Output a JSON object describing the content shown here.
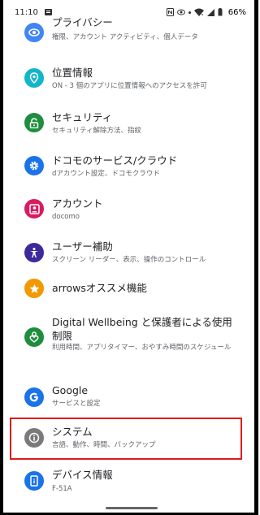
{
  "status_bar": {
    "time": "11:10",
    "battery": "66%"
  },
  "settings": {
    "items": [
      {
        "key": "privacy",
        "title": "プライバシー",
        "subtitle": "権限、アカウント アクティビティ、個人データ",
        "icon": "eye-icon",
        "color": "#4285f4"
      },
      {
        "key": "location",
        "title": "位置情報",
        "subtitle": "ON - 3 個のアプリに位置情報へのアクセスを許可",
        "icon": "location-pin-icon",
        "color": "#12b5cb"
      },
      {
        "key": "security",
        "title": "セキュリティ",
        "subtitle": "セキュリティ解除方法、指紋",
        "icon": "lock-icon",
        "color": "#1e8e3e"
      },
      {
        "key": "docomo",
        "title": "ドコモのサービス/クラウド",
        "subtitle": "dアカウント設定、ドコモクラウド",
        "icon": "gear-icon",
        "color": "#1a73e8"
      },
      {
        "key": "account",
        "title": "アカウント",
        "subtitle": "docomo",
        "icon": "account-box-icon",
        "color": "#d81b60"
      },
      {
        "key": "accessibility",
        "title": "ユーザー補助",
        "subtitle": "スクリーン リーダー、表示、操作のコントロール",
        "icon": "accessibility-icon",
        "color": "#3c2a9a"
      },
      {
        "key": "arrows",
        "title": "arrowsオススメ機能",
        "subtitle": "",
        "icon": "star-icon",
        "color": "#f29900"
      },
      {
        "key": "wellbeing",
        "title": "Digital Wellbeing と保護者による使用制限",
        "subtitle": "利用時間、アプリタイマー、おやすみ時間のスケジュール",
        "icon": "wellbeing-icon",
        "color": "#1e8e3e"
      },
      {
        "key": "google",
        "title": "Google",
        "subtitle": "サービスと設定",
        "icon": "google-icon",
        "color": "#1a73e8"
      },
      {
        "key": "system",
        "title": "システム",
        "subtitle": "言語、動作、時間、バックアップ",
        "icon": "info-icon",
        "color": "#7a7a7a"
      },
      {
        "key": "device",
        "title": "デバイス情報",
        "subtitle": "F-51A",
        "icon": "device-info-icon",
        "color": "#1a73e8"
      }
    ]
  },
  "highlight_color": "#e01b1b"
}
